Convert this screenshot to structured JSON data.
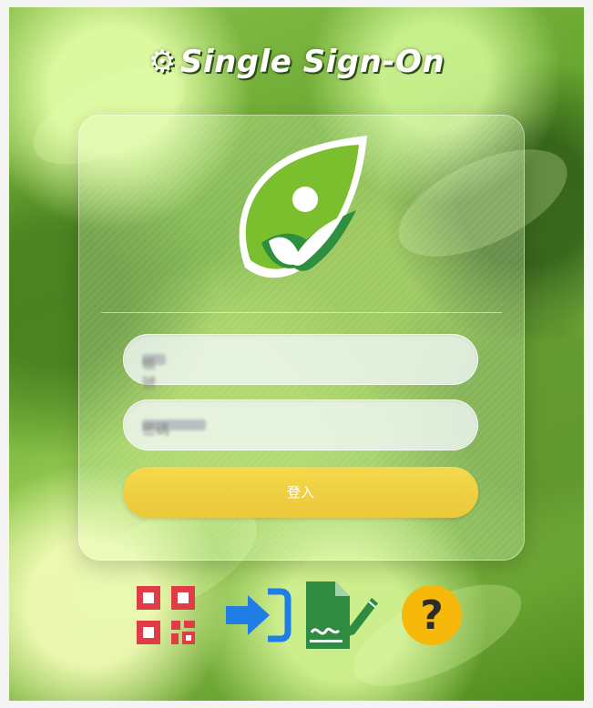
{
  "header": {
    "gear_icon": "gear-icon",
    "title": "Single Sign-On"
  },
  "login_card": {
    "logo": "leaf-person-logo",
    "username": {
      "placeholder": "帳號",
      "value": ""
    },
    "password": {
      "placeholder": "密碼",
      "value": ""
    },
    "login_label": "登入"
  },
  "tools": [
    {
      "icon": "qr-code-icon",
      "label": "QR Code"
    },
    {
      "icon": "login-arrow-icon",
      "label": "Login"
    },
    {
      "icon": "sign-document-icon",
      "label": "Sign"
    },
    {
      "icon": "help-icon",
      "label": "Help"
    }
  ],
  "colors": {
    "qr_red": "#e03c48",
    "arrow_blue": "#1e7ee6",
    "doc_green": "#2f8b42",
    "help_yellow": "#f6b80a",
    "login_yellow": "#f1d142"
  }
}
